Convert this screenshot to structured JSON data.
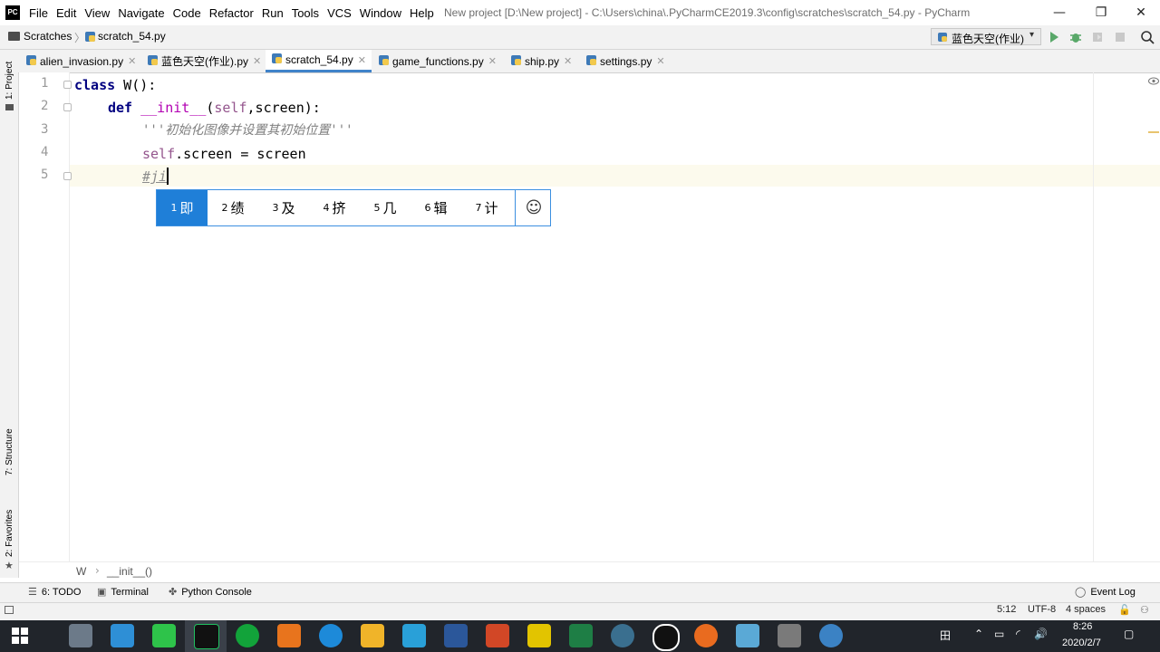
{
  "window": {
    "logo_text": "PC",
    "title": "New project [D:\\New project] - C:\\Users\\china\\.PyCharmCE2019.3\\config\\scratches\\scratch_54.py - PyCharm",
    "minimize": "—",
    "restore": "❐",
    "close": "✕"
  },
  "menu": {
    "items": [
      {
        "label": "File"
      },
      {
        "label": "Edit"
      },
      {
        "label": "View"
      },
      {
        "label": "Navigate"
      },
      {
        "label": "Code"
      },
      {
        "label": "Refactor"
      },
      {
        "label": "Run"
      },
      {
        "label": "Tools"
      },
      {
        "label": "VCS"
      },
      {
        "label": "Window"
      },
      {
        "label": "Help"
      }
    ]
  },
  "navbar": {
    "root": "Scratches",
    "separator": "〉",
    "file": "scratch_54.py",
    "run_config": "蓝色天空(作业)",
    "run_config_arrow": "▾"
  },
  "tabs": [
    {
      "label": "alien_invasion.py",
      "active": false
    },
    {
      "label": "蓝色天空(作业).py",
      "active": false
    },
    {
      "label": "scratch_54.py",
      "active": true
    },
    {
      "label": "game_functions.py",
      "active": false
    },
    {
      "label": "ship.py",
      "active": false
    },
    {
      "label": "settings.py",
      "active": false
    }
  ],
  "left_strip": {
    "project": "1: Project",
    "structure": "7: Structure",
    "favorites": "2: Favorites"
  },
  "editor": {
    "line_numbers": [
      "1",
      "2",
      "3",
      "4",
      "5"
    ],
    "lines": {
      "l1_kw": "class",
      "l1_rest": " W():",
      "l2_kw": "def",
      "l2_name": "__init__",
      "l2_open": "(",
      "l2_self": "self",
      "l2_rest": ",screen):",
      "l3_doc": "'''初始化图像并设置其初始位置'''",
      "l4_self": "self",
      "l4_rest": ".screen = screen",
      "l5_comment": "#ji"
    }
  },
  "ime": {
    "candidates": [
      {
        "num": "1",
        "text": "即",
        "selected": true
      },
      {
        "num": "2",
        "text": "绩",
        "selected": false
      },
      {
        "num": "3",
        "text": "及",
        "selected": false
      },
      {
        "num": "4",
        "text": "挤",
        "selected": false
      },
      {
        "num": "5",
        "text": "几",
        "selected": false
      },
      {
        "num": "6",
        "text": "辑",
        "selected": false
      },
      {
        "num": "7",
        "text": "计",
        "selected": false
      }
    ],
    "emoji": "☺"
  },
  "breadcrumb": {
    "class": "W",
    "separator": "›",
    "method": "__init__()"
  },
  "tool_windows": {
    "todo": "6: TODO",
    "terminal": "Terminal",
    "python_console": "Python Console",
    "event_log": "Event Log"
  },
  "status": {
    "position": "5:12",
    "encoding": "UTF-8",
    "indent": "4 spaces"
  },
  "taskbar": {
    "time": "8:26",
    "date": "2020/2/7",
    "ime_indicator": "田",
    "volume": "🔊"
  },
  "colors": {
    "accent": "#4083c9",
    "ime_selected": "#1f7fd8",
    "keyword": "#000080",
    "self": "#94558d",
    "dunder": "#b200b2",
    "docstring": "#808080",
    "current_line": "#fcfaed",
    "run_green": "#59a869"
  }
}
